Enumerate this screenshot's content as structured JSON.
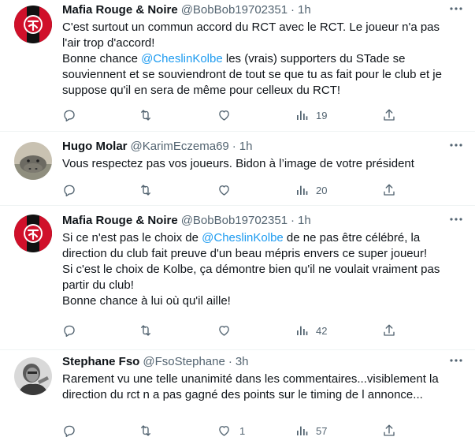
{
  "colors": {
    "text": "#0f1419",
    "secondary": "#536471",
    "link": "#1d9bf0",
    "divider": "#eff3f4",
    "stade_red": "#d0102a",
    "stade_black": "#111111"
  },
  "tweets": [
    {
      "name": "Mafia Rouge & Noire",
      "handle": "@BobBob19702351",
      "time": "1h",
      "avatar_icon": "stade-toulousain-logo-avatar",
      "lines": [
        [
          "C'est surtout un commun accord du RCT avec le RCT. Le joueur n'a pas"
        ],
        [
          "l'air trop d'accord!"
        ],
        [
          "Bonne chance ",
          {
            "mention": "@CheslinKolbe"
          },
          " les (vrais) supporters du STade se"
        ],
        [
          "souviennent et se souviendront de tout se que tu as fait pour le club et je"
        ],
        [
          "suppose qu'il en sera de même pour celleux du RCT!"
        ]
      ],
      "replies": "",
      "retweets": "",
      "likes": "",
      "views": "19"
    },
    {
      "name": "Hugo Molar",
      "handle": "@KarimEczema69",
      "time": "1h",
      "avatar_icon": "hippo-photo-avatar",
      "lines": [
        [
          "Vous respectez pas vos joueurs. Bidon à l’image de votre président"
        ]
      ],
      "replies": "",
      "retweets": "",
      "likes": "",
      "views": "20"
    },
    {
      "name": "Mafia Rouge & Noire",
      "handle": "@BobBob19702351",
      "time": "1h",
      "avatar_icon": "stade-toulousain-logo-avatar",
      "lines": [
        [
          "Si ce n'est pas le choix de ",
          {
            "mention": "@CheslinKolbe"
          },
          " de ne pas être célébré, la"
        ],
        [
          "direction du club fait preuve d'un beau mépris envers ce super joueur!"
        ],
        [
          "Si c'est le choix de Kolbe, ça démontre bien qu'il ne voulait vraiment pas"
        ],
        [
          "partir du club!"
        ],
        [
          "Bonne chance à lui où qu'il aille!"
        ]
      ],
      "replies": "",
      "retweets": "",
      "likes": "",
      "views": "42"
    },
    {
      "name": "Stephane Fso",
      "handle": "@FsoStephane",
      "time": "3h",
      "avatar_icon": "person-photo-avatar",
      "lines": [
        [
          "Rarement vu une telle unanimité dans les commentaires...visiblement la"
        ],
        [
          "direction du rct n a pas gagné des points sur le timing de l annonce..."
        ]
      ],
      "replies": "",
      "retweets": "",
      "likes": "1",
      "views": "57"
    }
  ],
  "separator": "·"
}
